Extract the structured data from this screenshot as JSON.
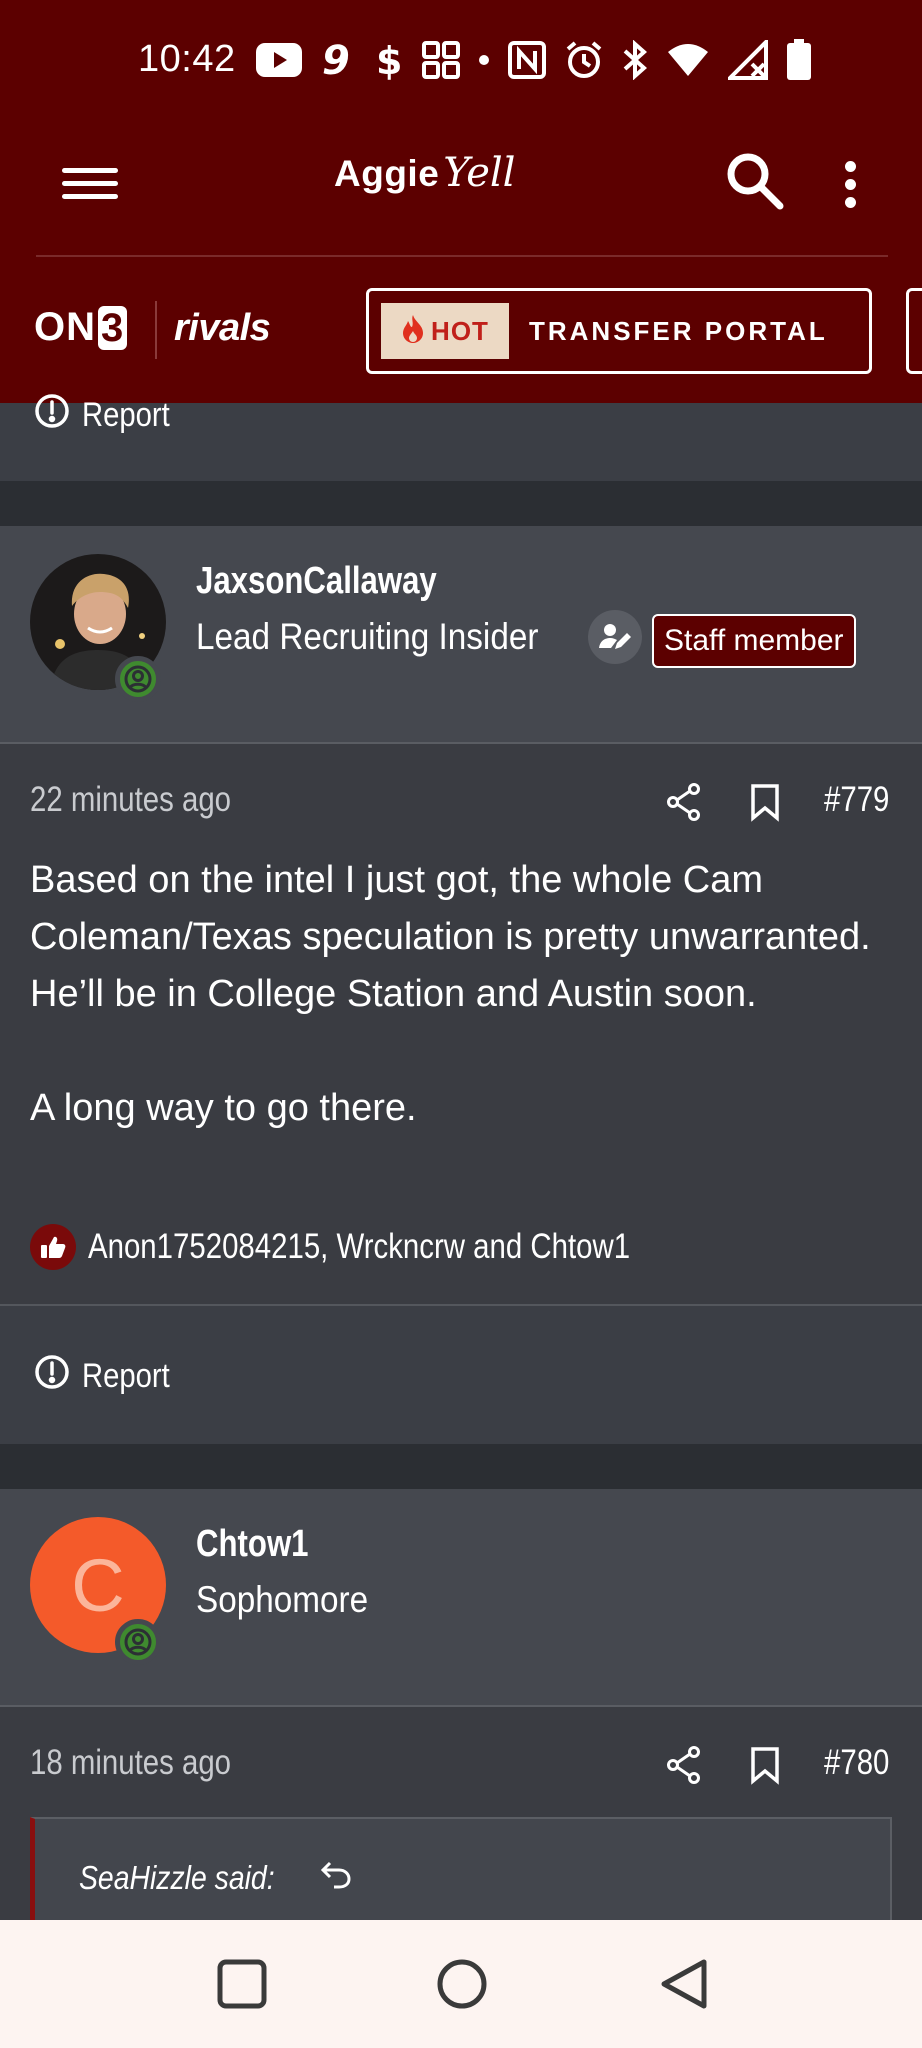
{
  "status_bar": {
    "time": "10:42",
    "icons": [
      "youtube-icon",
      "app-9-icon",
      "dollar-icon",
      "widgets-icon",
      "dot-icon",
      "nfc-icon",
      "alarm-icon",
      "bluetooth-icon",
      "wifi-icon",
      "signal-icon",
      "battery-icon"
    ]
  },
  "header": {
    "logo_bold": "Aggie",
    "logo_script": "Yell"
  },
  "brand_bar": {
    "on3": "ON",
    "on3_num": "3",
    "rivals": "rivals",
    "hot_label": "HOT",
    "portal_label": "TRANSFER PORTAL"
  },
  "top_report": {
    "label": "Report"
  },
  "posts": [
    {
      "username": "JaxsonCallaway",
      "user_title": "Lead Recruiting Insider",
      "staff_badge": "Staff member",
      "time_ago": "22 minutes ago",
      "post_number": "#779",
      "message": [
        "Based on the intel I just got, the whole Cam Coleman/Texas speculation is pretty unwarranted. He’ll be in College Station and Austin soon.",
        "A long way to go there."
      ],
      "reactions": "Anon1752084215, Wrckncrw and Chtow1",
      "report_label": "Report"
    },
    {
      "username": "Chtow1",
      "avatar_letter": "C",
      "user_title": "Sophomore",
      "time_ago": "18 minutes ago",
      "post_number": "#780",
      "quote_author": "SeaHizzle said:"
    }
  ],
  "colors": {
    "brand_maroon": "#5c0000",
    "avatar_orange": "#f45a2a",
    "online_green": "#3f8a2f"
  }
}
